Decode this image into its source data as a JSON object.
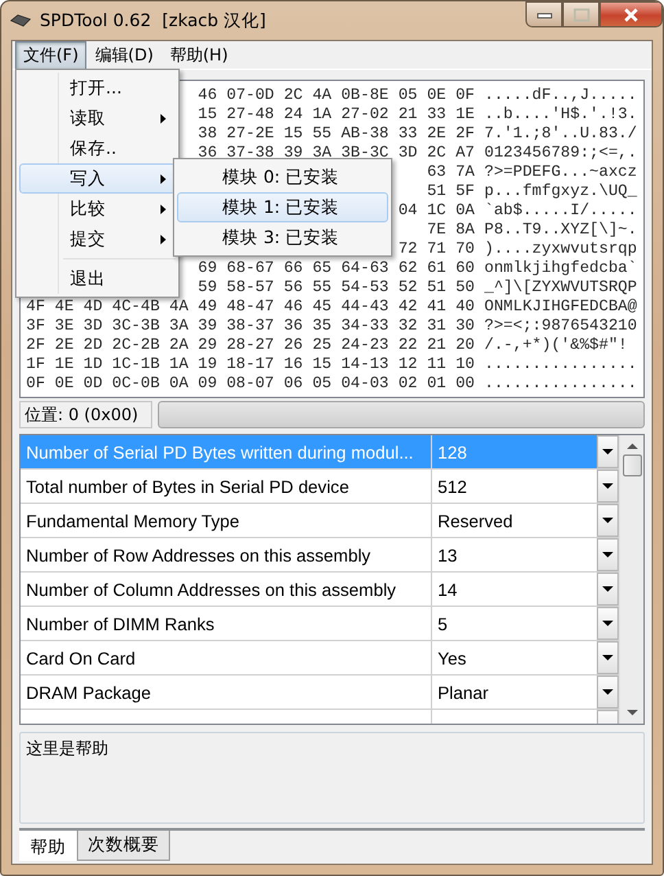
{
  "window": {
    "title": "SPDTool 0.62  [zkacb 汉化]"
  },
  "menubar": [
    {
      "label": "文件(F)",
      "selected": true
    },
    {
      "label": "编辑(D)",
      "selected": false
    },
    {
      "label": "帮助(H)",
      "selected": false
    }
  ],
  "menu": {
    "items": [
      {
        "kind": "item",
        "label": "打开...",
        "selected": false
      },
      {
        "kind": "submenu",
        "label": "读取",
        "selected": false
      },
      {
        "kind": "item",
        "label": "保存..",
        "selected": false
      },
      {
        "kind": "submenu",
        "label": "写入",
        "selected": true
      },
      {
        "kind": "submenu",
        "label": "比较",
        "selected": false
      },
      {
        "kind": "submenu",
        "label": "提交",
        "selected": false
      },
      {
        "kind": "separator"
      },
      {
        "kind": "item",
        "label": "退出",
        "selected": false
      }
    ]
  },
  "submenu": {
    "items": [
      {
        "label": "模块 0: 已安装",
        "selected": false
      },
      {
        "label": "模块 1: 已安装",
        "selected": true
      },
      {
        "label": "模块 3: 已安装",
        "selected": false
      }
    ]
  },
  "hex_dump": {
    "rows": [
      {
        "hex": "46 07-0D 2C 4A 0B-8E 05 0E 0F",
        "ascii": ".....dF..,J....."
      },
      {
        "hex": "15 27-48 24 1A 27-02 21 33 1E",
        "ascii": "..b....'H$.'.!3."
      },
      {
        "hex": "38 27-2E 15 55 AB-38 33 2E 2F",
        "ascii": "7.'1.;8'..U.83./"
      },
      {
        "hex": "36 37-38 39 3A 3B-3C 3D 2C A7",
        "ascii": "0123456789:;<=,."
      },
      {
        "hex": "63 7A",
        "ascii": "?>=PDEFG...~axcz"
      },
      {
        "hex": "51 5F",
        "ascii": "p...fmfgxyz.\\UQ_"
      },
      {
        "hex": "04 1C 0A",
        "ascii": "`ab$.....I/....."
      },
      {
        "hex": "7E 8A",
        "ascii": "P8..T9..XYZ[\\]~."
      },
      {
        "hex": "72 71 70",
        "ascii": ")....zyxwvutsrqp"
      },
      {
        "hex": "69 68-67 66 65 64-63 62 61 60",
        "ascii": "onmlkjihgfedcba`"
      },
      {
        "hex": "59 58-57 56 55 54-53 52 51 50",
        "ascii": "_^]\\[ZYXWVUTSRQP"
      },
      {
        "hex": "4F 4E 4D 4C-4B 4A 49 48-47 46 45 44-43 42 41 40",
        "ascii": "ONMLKJIHGFEDCBA@"
      },
      {
        "hex": "3F 3E 3D 3C-3B 3A 39 38-37 36 35 34-33 32 31 30",
        "ascii": "?>=<;:9876543210"
      },
      {
        "hex": "2F 2E 2D 2C-2B 2A 29 28-27 26 25 24-23 22 21 20",
        "ascii": "/.-,+*)('&%$#\"!"
      },
      {
        "hex": "1F 1E 1D 1C-1B 1A 19 18-17 16 15 14-13 12 11 10",
        "ascii": "................"
      },
      {
        "hex": "0F 0E 0D 0C-0B 0A 09 08-07 06 05 04-03 02 01 00",
        "ascii": "................"
      }
    ]
  },
  "status": {
    "position": "位置: 0 (0x00)",
    "progress": {
      "level": 0
    }
  },
  "properties": {
    "rows": [
      {
        "name": "Number of Serial PD Bytes written during modul...",
        "value": "128",
        "selected": true
      },
      {
        "name": "Total number of Bytes in Serial PD device",
        "value": "512",
        "selected": false
      },
      {
        "name": "Fundamental Memory Type",
        "value": "Reserved",
        "selected": false
      },
      {
        "name": "Number of Row Addresses on this assembly",
        "value": "13",
        "selected": false
      },
      {
        "name": "Number of Column Addresses on this assembly",
        "value": "14",
        "selected": false
      },
      {
        "name": "Number of DIMM Ranks",
        "value": "5",
        "selected": false
      },
      {
        "name": "Card On Card",
        "value": "Yes",
        "selected": false
      },
      {
        "name": "DRAM Package",
        "value": "Planar",
        "selected": false
      }
    ]
  },
  "help": {
    "text": "这里是帮助"
  },
  "bottom_tabs": [
    {
      "label": "帮助",
      "selected": true
    },
    {
      "label": "次数概要",
      "selected": false
    }
  ]
}
